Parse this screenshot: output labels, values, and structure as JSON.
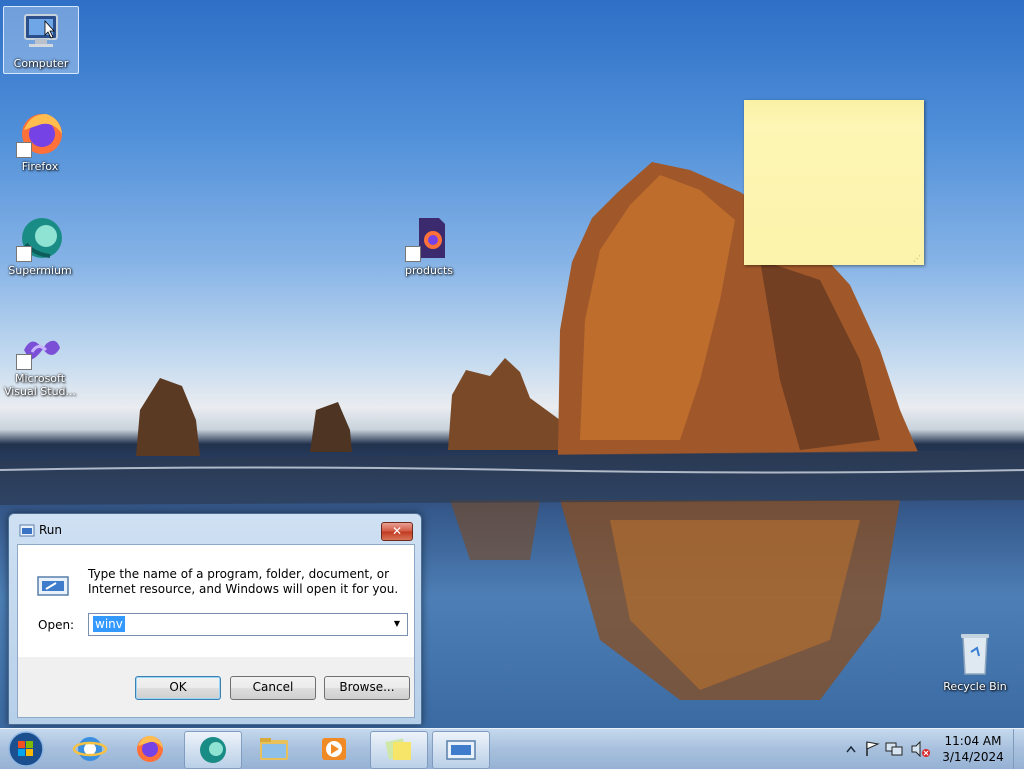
{
  "desktop": {
    "icons": [
      {
        "label": "Computer"
      },
      {
        "label": "Firefox"
      },
      {
        "label": "Supermium"
      },
      {
        "label": "Microsoft Visual Stud..."
      },
      {
        "label": "products"
      },
      {
        "label": "Recycle Bin"
      }
    ]
  },
  "run_dialog": {
    "title": "Run",
    "close_label": "✕",
    "description": "Type the name of a program, folder, document, or Internet resource, and Windows will open it for you.",
    "open_label": "Open:",
    "open_value": "winv",
    "ok_label": "OK",
    "cancel_label": "Cancel",
    "browse_label": "Browse..."
  },
  "taskbar": {
    "start_icon": "windows-start-orb-icon",
    "pinned": [
      "internet-explorer-icon",
      "firefox-icon",
      "supermium-icon",
      "file-explorer-icon",
      "media-player-icon",
      "sticky-notes-icon",
      "run-window-icon"
    ],
    "tray_icons": [
      "show-hidden-icons-chevron",
      "action-center-flag-icon",
      "network-icon",
      "volume-muted-icon"
    ],
    "time": "11:04 AM",
    "date": "3/14/2024"
  },
  "colors": {
    "sticky_note": "#fcf3ab",
    "selection": "#3399ff",
    "taskbar": "#a7c0dd"
  }
}
